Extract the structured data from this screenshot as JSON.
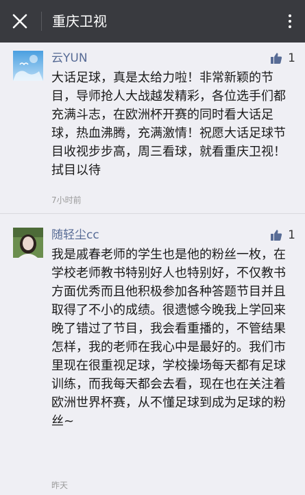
{
  "header": {
    "title": "重庆卫视",
    "close_icon": "close-icon",
    "more_icon": "more-vertical-icon"
  },
  "comments": [
    {
      "nickname": "云YUN",
      "likes": "1",
      "text": "大话足球，真是太给力啦！非常新颖的节目，导师抢人大战越发精彩，各位选手们都充满斗志，在欧洲杯开赛的同时看大话足球，热血沸腾，充满激情！祝愿大话足球节目收视步步高，周三看球，就看重庆卫视！拭目以待",
      "time": "7小时前",
      "avatar_colors": [
        "#4a9fe0",
        "#b9dcf6"
      ]
    },
    {
      "nickname": "随轻尘cc",
      "likes": "1",
      "text": "我是戚春老师的学生也是他的粉丝一枚，在学校老师教书特别好人也特别好，不仅教书方面优秀而且他积极参加各种答题节目并且取得了不小的成绩。很遗憾今晚我上学回来晚了错过了节目，我会看重播的，不管结果怎样，我的老师在我心中是最好的。我们市里现在很重视足球，学校操场每天都有足球训练，而我每天都会去看，现在也在关注着欧洲世界杯赛，从不懂足球到成为足球的粉丝~",
      "time": "昨天",
      "avatar_colors": [
        "#6b8e4e",
        "#e9d7cf"
      ]
    }
  ],
  "colors": {
    "topbar": "#393a3f",
    "nickname": "#576b95",
    "like_icon": "#576b95",
    "background": "#efeff4"
  }
}
